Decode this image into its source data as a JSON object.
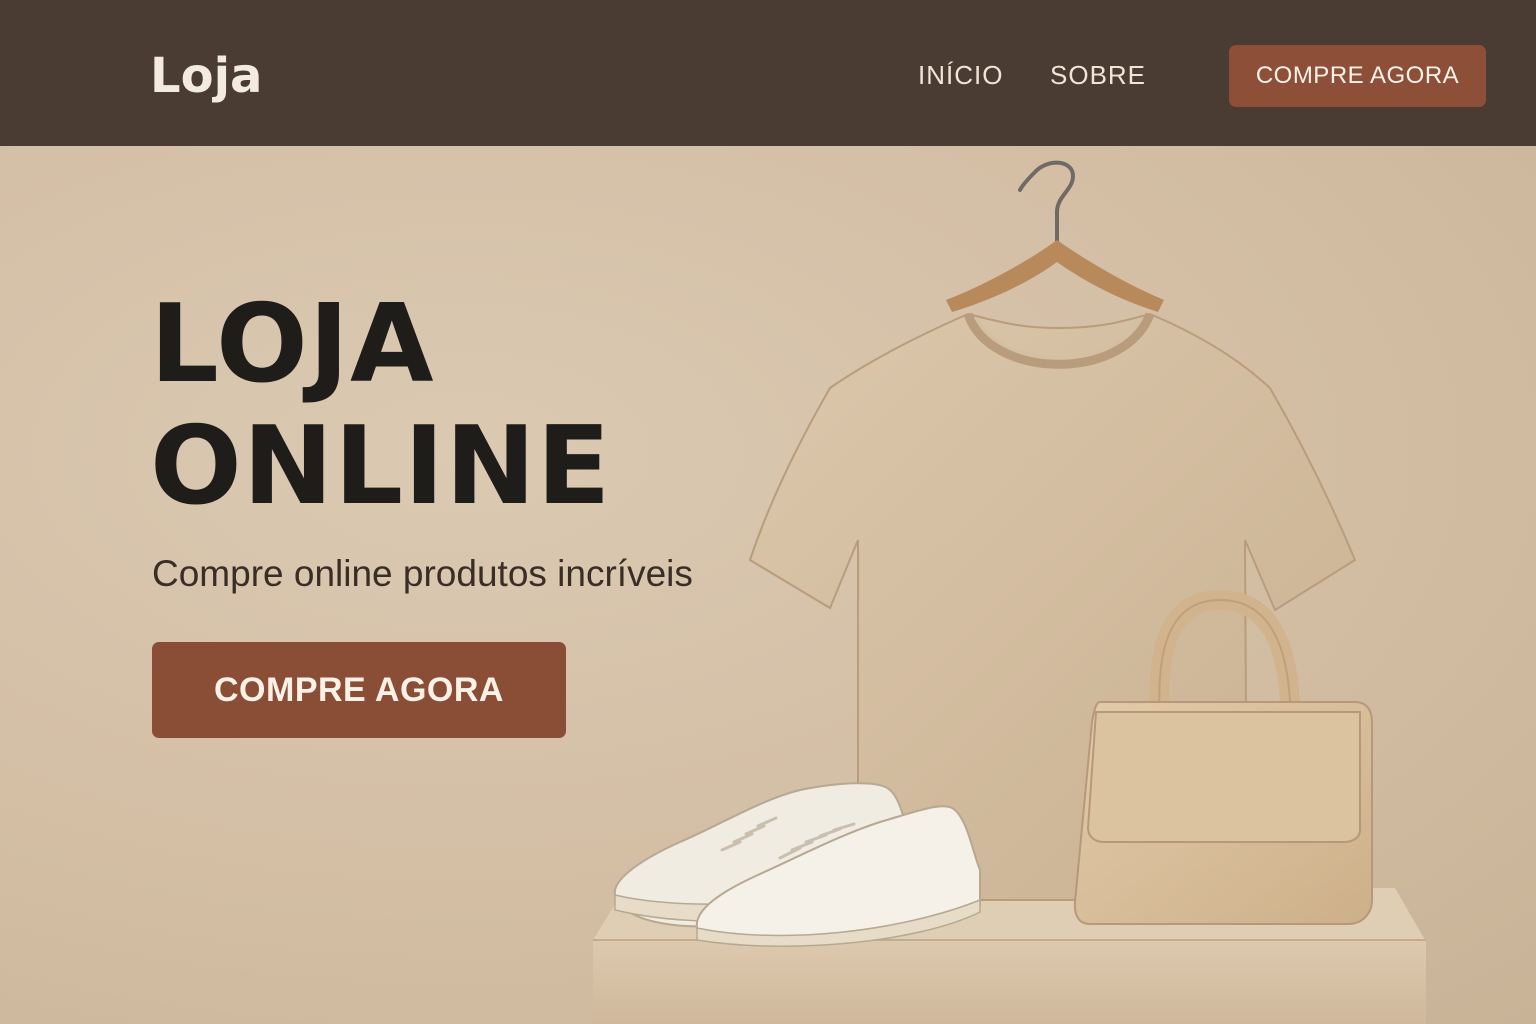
{
  "header": {
    "brand": "Loja",
    "nav": [
      {
        "label": "INÍCIO"
      },
      {
        "label": "SOBRE"
      }
    ],
    "cta_label": "COMPRE AGORA"
  },
  "hero": {
    "title_line1": "LOJA",
    "title_line2": "ONLINE",
    "subtitle": "Compre online produtos incríveis",
    "cta_label": "COMPRE AGORA",
    "image_items": [
      "hanger",
      "t-shirt",
      "sneakers",
      "handbag",
      "display-pedestal"
    ]
  },
  "colors": {
    "header_bg": "#4a3b33",
    "page_bg": "#d6c3ab",
    "accent": "#8a4e36",
    "title_text": "#1f1d1a"
  }
}
